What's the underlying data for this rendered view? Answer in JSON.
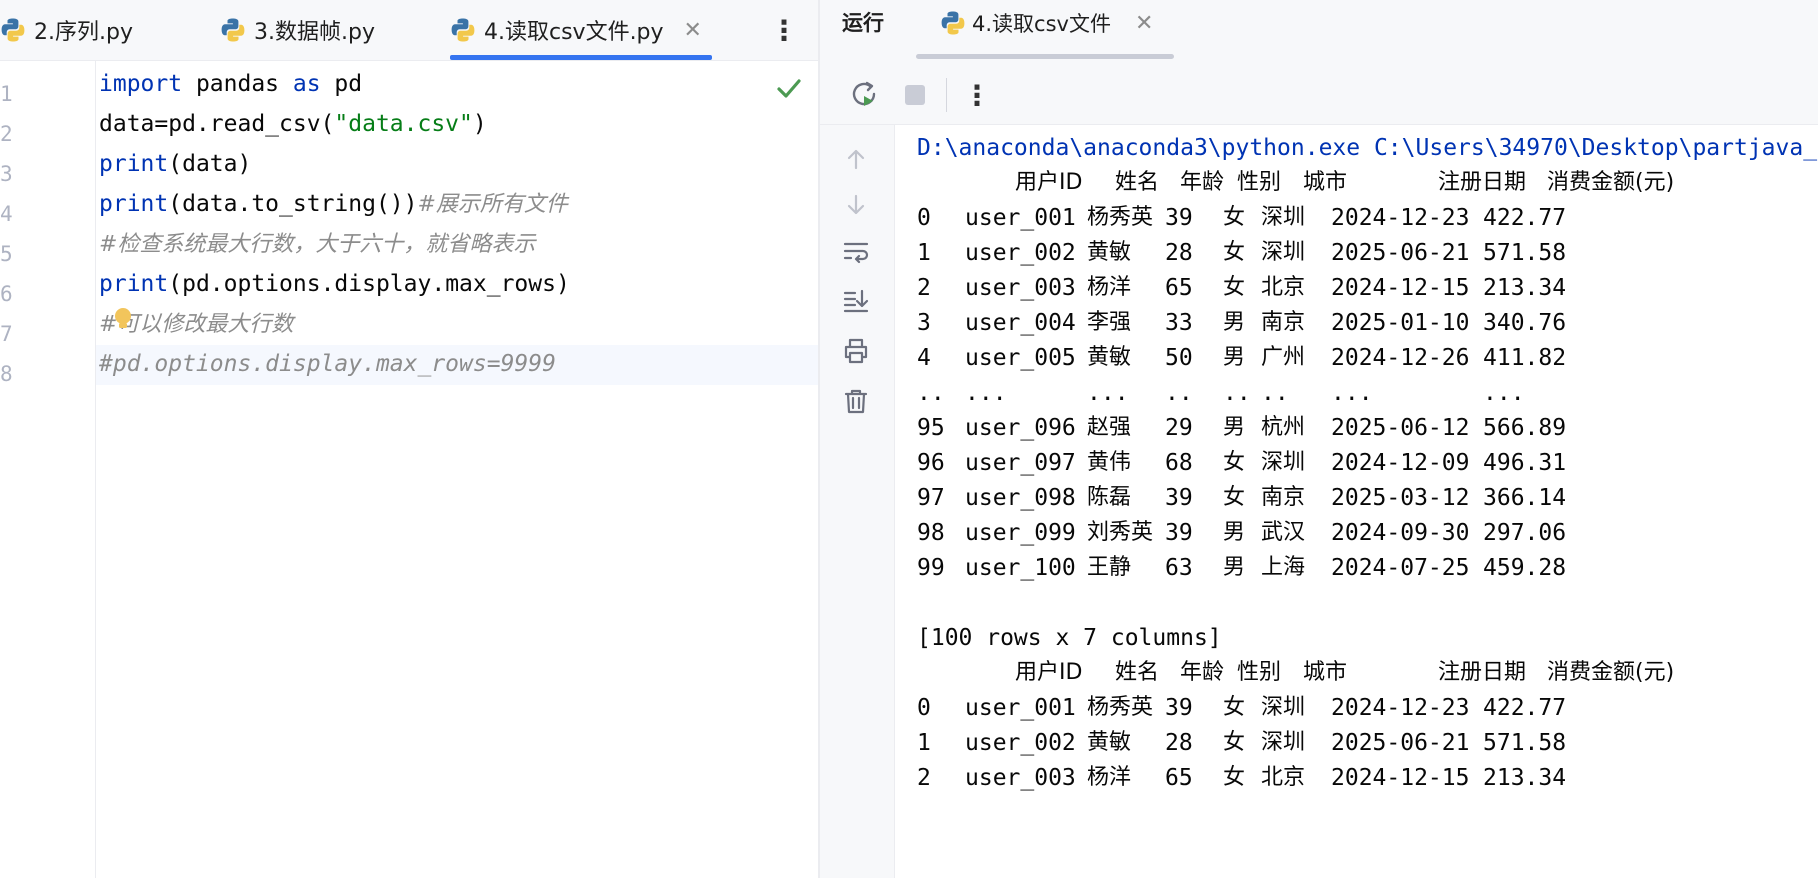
{
  "editor": {
    "tabs": [
      {
        "label": "2.序列.py"
      },
      {
        "label": "3.数据帧.py"
      },
      {
        "label": "4.读取csv文件.py",
        "active": true
      }
    ],
    "line_numbers": [
      "1",
      "2",
      "3",
      "4",
      "5",
      "6",
      "7",
      "8"
    ],
    "code": {
      "l1": {
        "kw1": "import",
        "mid": " pandas ",
        "kw2": "as",
        "end": " pd"
      },
      "l2": {
        "pre": "data=pd.read_csv(",
        "str": "\"data.csv\"",
        "post": ")"
      },
      "l3": {
        "kw": "print",
        "rest": "(data)"
      },
      "l4": {
        "kw": "print",
        "rest": "(data.to_string())",
        "comment": "#展示所有文件"
      },
      "l5": {
        "comment": "#检查系统最大行数，大于六十，就省略表示"
      },
      "l6": {
        "kw": "print",
        "rest": "(pd.options.display.max_rows)"
      },
      "l7": {
        "comment": "#可以修改最大行数"
      },
      "l8": {
        "comment": "#pd.options.display.max_rows=9999"
      }
    }
  },
  "run_panel": {
    "title": "运行",
    "tab_label": "4.读取csv文件",
    "console": {
      "path_line": "D:\\anaconda\\anaconda3\\python.exe C:\\Users\\34970\\Desktop\\partjava_",
      "headers": [
        "用户ID",
        "姓名",
        "年龄",
        "性别",
        "城市",
        "注册日期",
        "消费金额(元)"
      ],
      "rows_block1": [
        [
          "0",
          "user_001",
          "杨秀英",
          "39",
          "女",
          "深圳",
          "2024-12-23",
          "422.77"
        ],
        [
          "1",
          "user_002",
          "黄敏",
          "28",
          "女",
          "深圳",
          "2025-06-21",
          "571.58"
        ],
        [
          "2",
          "user_003",
          "杨洋",
          "65",
          "女",
          "北京",
          "2024-12-15",
          "213.34"
        ],
        [
          "3",
          "user_004",
          "李强",
          "33",
          "男",
          "南京",
          "2025-01-10",
          "340.76"
        ],
        [
          "4",
          "user_005",
          "黄敏",
          "50",
          "男",
          "广州",
          "2024-12-26",
          "411.82"
        ]
      ],
      "ellipsis_row": [
        "..",
        "...",
        "...",
        "..",
        "..",
        "..",
        "...",
        "..."
      ],
      "rows_block2": [
        [
          "95",
          "user_096",
          "赵强",
          "29",
          "男",
          "杭州",
          "2025-06-12",
          "566.89"
        ],
        [
          "96",
          "user_097",
          "黄伟",
          "68",
          "女",
          "深圳",
          "2024-12-09",
          "496.31"
        ],
        [
          "97",
          "user_098",
          "陈磊",
          "39",
          "女",
          "南京",
          "2025-03-12",
          "366.14"
        ],
        [
          "98",
          "user_099",
          "刘秀英",
          "39",
          "男",
          "武汉",
          "2024-09-30",
          "297.06"
        ],
        [
          "99",
          "user_100",
          "王静",
          "63",
          "男",
          "上海",
          "2024-07-25",
          "459.28"
        ]
      ],
      "summary": "[100 rows x 7 columns]",
      "rows_block3": [
        [
          "0",
          "user_001",
          "杨秀英",
          "39",
          "女",
          "深圳",
          "2024-12-23",
          "422.77"
        ],
        [
          "1",
          "user_002",
          "黄敏",
          "28",
          "女",
          "深圳",
          "2025-06-21",
          "571.58"
        ],
        [
          "2",
          "user_003",
          "杨洋",
          "65",
          "女",
          "北京",
          "2024-12-15",
          "213.34"
        ]
      ]
    }
  },
  "colors": {
    "keyword": "#0033b3",
    "string": "#067d17",
    "comment": "#8c8c8c",
    "accent": "#3574f0",
    "success": "#4c9a52"
  },
  "icons": [
    "python-icon",
    "close-icon",
    "more-vertical-icon",
    "check-icon",
    "lightbulb-icon",
    "rerun-icon",
    "stop-icon",
    "arrow-up-icon",
    "arrow-down-icon",
    "soft-wrap-icon",
    "scroll-to-end-icon",
    "print-icon",
    "trash-icon"
  ]
}
